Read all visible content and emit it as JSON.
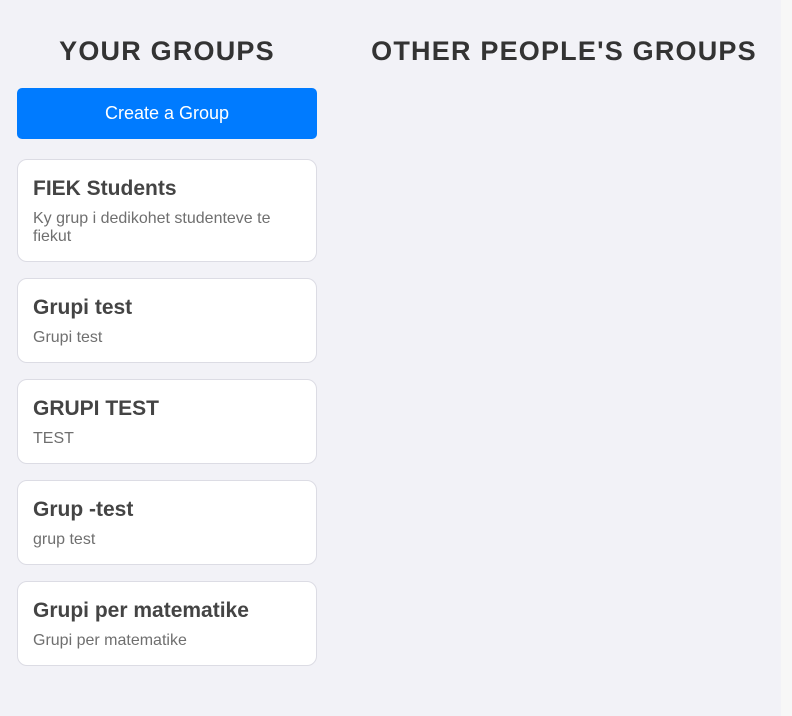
{
  "your_groups": {
    "title": "YOUR GROUPS",
    "create_button_label": "Create a Group",
    "groups": [
      {
        "name": "FIEK Students",
        "description": "Ky grup i dedikohet studenteve te fiekut"
      },
      {
        "name": "Grupi test",
        "description": "Grupi test"
      },
      {
        "name": "GRUPI TEST",
        "description": "TEST"
      },
      {
        "name": "Grup -test",
        "description": "grup test"
      },
      {
        "name": "Grupi per matematike",
        "description": "Grupi per matematike"
      }
    ]
  },
  "other_groups": {
    "title": "OTHER PEOPLE'S GROUPS"
  },
  "colors": {
    "background": "#f2f2f7",
    "primary_button": "#007bff",
    "card_background": "#ffffff",
    "heading_text": "#333333"
  }
}
